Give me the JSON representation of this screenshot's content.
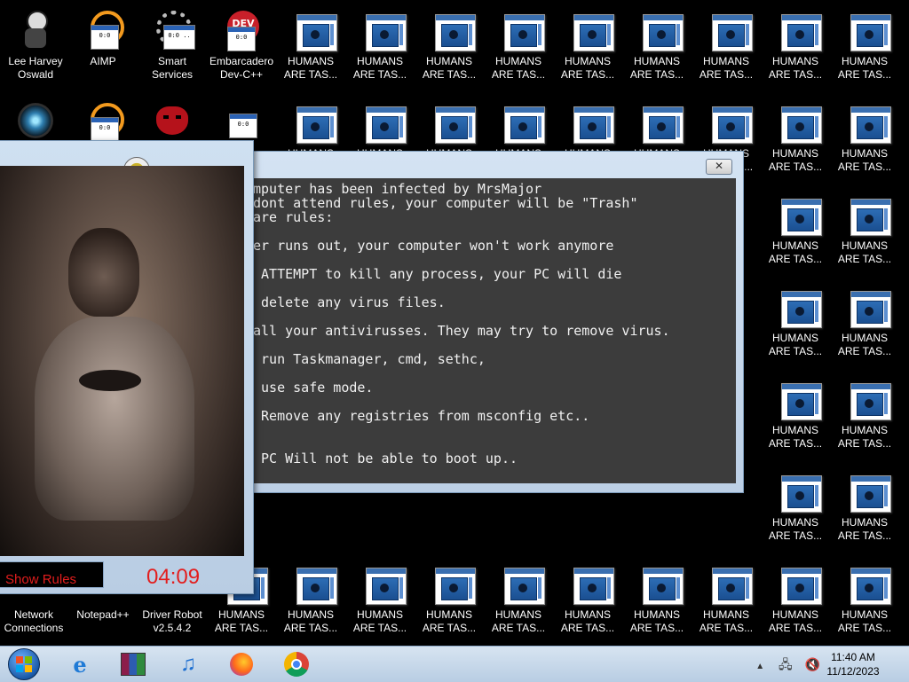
{
  "desktop": {
    "top_icons": [
      {
        "label1": "Lee Harvey",
        "label2": "Oswald",
        "icon": "doll-icon"
      },
      {
        "label1": "AIMP",
        "label2": "",
        "icon": "aimp-icon"
      },
      {
        "label1": "Smart",
        "label2": "Services",
        "icon": "gear-icon"
      },
      {
        "label1": "Embarcadero",
        "label2": "Dev-C++",
        "icon": "devcpp-icon"
      }
    ],
    "second_row_icons": [
      {
        "icon": "orb-icon"
      },
      {
        "icon": "aimp-icon"
      },
      {
        "icon": "devil-icon"
      },
      {
        "icon": "app-window-icon"
      }
    ],
    "bottom_icons": [
      {
        "label1": "Network",
        "label2": "Connections",
        "icon": "network-icon"
      },
      {
        "label1": "Notepad++",
        "label2": "",
        "icon": "notepad-icon"
      },
      {
        "label1": "Driver Robot",
        "label2": "v2.5.4.2",
        "icon": "driver-robot-icon"
      }
    ],
    "humans_label1": "HUMANS",
    "humans_label2": "ARE TAS...",
    "humans_partial_label": "HUMANS"
  },
  "video_window": {
    "button_label": "Show Rules",
    "timer": "04:09"
  },
  "rules_window": {
    "close_label": "✕",
    "lines": [
      "mputer has been infected by MrsMajor",
      "dont attend rules, your computer will be \"Trash\"",
      "are rules:",
      "er runs out, your computer won't work anymore",
      " ATTEMPT to kill any process, your PC will die",
      " delete any virus files.",
      "all your antivirusses. They may try to remove virus.",
      " run Taskmanager, cmd, sethc,",
      " use safe mode.",
      " Remove any registries from msconfig etc..",
      " PC Will not be able to boot up.."
    ]
  },
  "taskbar": {
    "apps": [
      "ie-icon",
      "archive-icon",
      "music-icon",
      "firefox-icon",
      "chrome-icon"
    ],
    "time": "11:40 AM",
    "date": "11/12/2023"
  },
  "colors": {
    "timer_red": "#e31d1d",
    "taskbar_top": "#d7e4f1",
    "console_bg": "#3c3c3c"
  }
}
